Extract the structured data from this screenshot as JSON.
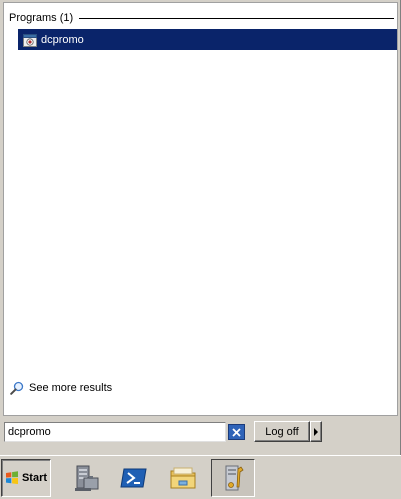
{
  "start_menu": {
    "group_header": "Programs (1)",
    "results": [
      {
        "label": "dcpromo",
        "icon": "dcpromo-program-icon",
        "selected": true
      }
    ],
    "see_more_label": "See more results",
    "search": {
      "value": "dcpromo"
    },
    "logoff_label": "Log off"
  },
  "taskbar": {
    "start_label": "Start",
    "pinned": [
      {
        "icon": "server-manager-icon"
      },
      {
        "icon": "powershell-icon"
      },
      {
        "icon": "windows-explorer-icon"
      },
      {
        "icon": "administrative-tools-icon",
        "active": true
      }
    ]
  },
  "colors": {
    "selection": "#0a246a",
    "selection_text": "#ffffff",
    "chrome": "#d4d0c8"
  }
}
